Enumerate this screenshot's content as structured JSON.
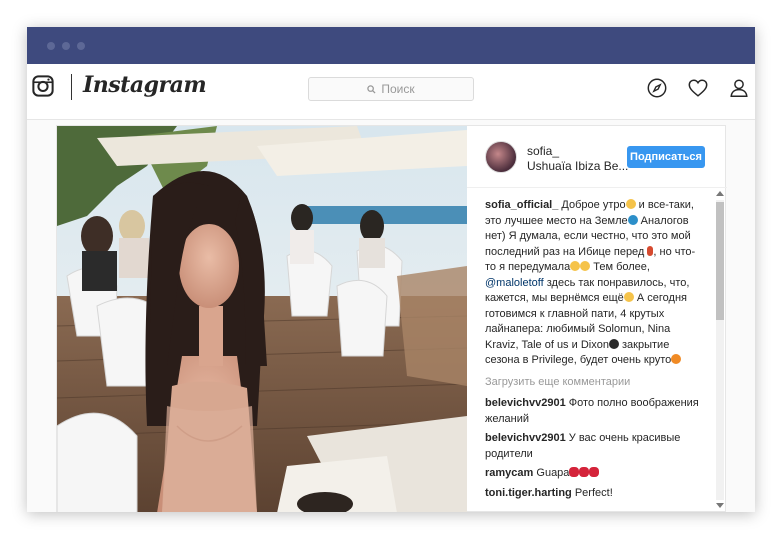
{
  "app": {
    "logo_text": "Instagram"
  },
  "search": {
    "placeholder": "Поиск"
  },
  "nav_icons": [
    "compass-icon",
    "heart-icon",
    "user-icon"
  ],
  "post": {
    "username": "sofia_",
    "location": "Ushuaïa Ibiza Be...",
    "follow_label": "Подписаться",
    "caption": {
      "author": "sofia_official_",
      "seg1": "Доброе утро",
      "seg2": "и все-таки, это лучшее место на Земле",
      "seg3": "Аналогов нет) Я думала, если честно, что это мой последний раз на Ибице перед",
      "seg4": ", но что-то я передумала",
      "seg5": "Тем более,",
      "mention": "@maloletoff",
      "seg6": "здесь так понравилось, что, кажется, мы вернёмся ещё",
      "seg7": "А сегодня готовимся к главной пати, 4 крутых лайнапера: любимый Solomun, Nina Kraviz, Tale of us и Dixon",
      "seg8": "закрытие сезона в Privilege, будет очень круто"
    },
    "load_more": "Загрузить еще комментарии",
    "comments": [
      {
        "user": "belevichvv2901",
        "text": "Фото полно воображения желаний"
      },
      {
        "user": "belevichvv2901",
        "text": "У вас очень красивые родители"
      },
      {
        "user": "ramycam",
        "text": "Guapa"
      },
      {
        "user": "toni.tiger.harting",
        "text": "Perfect!"
      }
    ]
  },
  "colors": {
    "titlebar": "#3e4a7e",
    "follow_button": "#3897f0",
    "mention": "#003569"
  }
}
